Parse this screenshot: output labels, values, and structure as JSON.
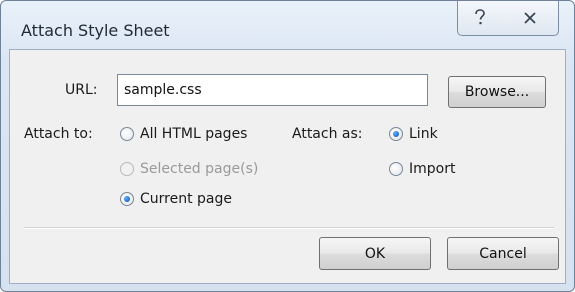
{
  "window": {
    "title": "Attach Style Sheet",
    "help_icon": "question-icon",
    "close_icon": "close-icon"
  },
  "url": {
    "label": "URL:",
    "value": "sample.css",
    "browse_label": "Browse..."
  },
  "attach_to": {
    "label": "Attach to:",
    "options": [
      {
        "label": "All HTML pages",
        "checked": false,
        "enabled": true
      },
      {
        "label": "Selected page(s)",
        "checked": false,
        "enabled": false
      },
      {
        "label": "Current page",
        "checked": true,
        "enabled": true
      }
    ]
  },
  "attach_as": {
    "label": "Attach as:",
    "options": [
      {
        "label": "Link",
        "checked": true,
        "enabled": true
      },
      {
        "label": "Import",
        "checked": false,
        "enabled": true
      }
    ]
  },
  "buttons": {
    "ok_label": "OK",
    "cancel_label": "Cancel"
  },
  "colors": {
    "frame": "#dbe6f3",
    "radio_checked": "#0a4aa8"
  }
}
